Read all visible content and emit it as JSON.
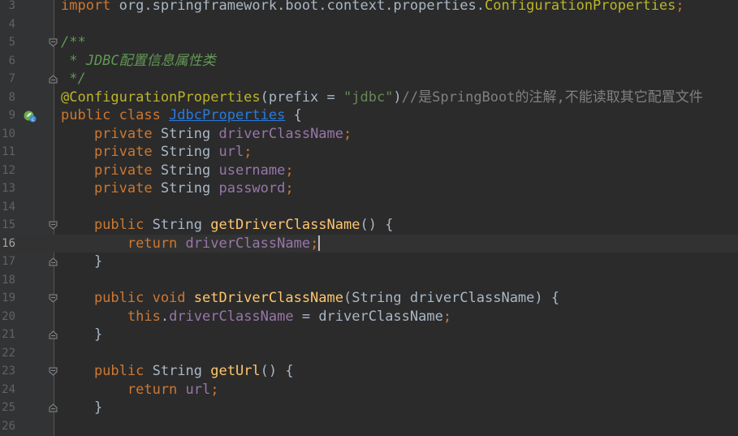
{
  "editor": {
    "current_line": "16",
    "lines": [
      {
        "num": "3",
        "tokens": [
          {
            "t": "kw",
            "v": "import"
          },
          {
            "t": "p",
            "v": " org.springframework.boot.context.properties."
          },
          {
            "t": "ann",
            "v": "ConfigurationProperties"
          },
          {
            "t": "kw",
            "v": ";"
          }
        ]
      },
      {
        "num": "4",
        "tokens": []
      },
      {
        "num": "5",
        "tokens": [
          {
            "t": "doc",
            "v": "/**"
          }
        ]
      },
      {
        "num": "6",
        "tokens": [
          {
            "t": "doc",
            "v": " * JDBC配置信息属性类"
          }
        ]
      },
      {
        "num": "7",
        "tokens": [
          {
            "t": "doc",
            "v": " */"
          }
        ]
      },
      {
        "num": "8",
        "tokens": [
          {
            "t": "ann",
            "v": "@ConfigurationProperties"
          },
          {
            "t": "p",
            "v": "(prefix = "
          },
          {
            "t": "str",
            "v": "\"jdbc\""
          },
          {
            "t": "p",
            "v": ")"
          },
          {
            "t": "cmt",
            "v": "//是SpringBoot的注解,不能读取其它配置文件"
          }
        ]
      },
      {
        "num": "9",
        "tokens": [
          {
            "t": "kw",
            "v": "public class "
          },
          {
            "t": "cls",
            "v": "JdbcProperties"
          },
          {
            "t": "p",
            "v": " {"
          }
        ]
      },
      {
        "num": "10",
        "tokens": [
          {
            "t": "kw",
            "v": "    private "
          },
          {
            "t": "p",
            "v": "String "
          },
          {
            "t": "field",
            "v": "driverClassName"
          },
          {
            "t": "kw",
            "v": ";"
          }
        ]
      },
      {
        "num": "11",
        "tokens": [
          {
            "t": "kw",
            "v": "    private "
          },
          {
            "t": "p",
            "v": "String "
          },
          {
            "t": "field",
            "v": "url"
          },
          {
            "t": "kw",
            "v": ";"
          }
        ]
      },
      {
        "num": "12",
        "tokens": [
          {
            "t": "kw",
            "v": "    private "
          },
          {
            "t": "p",
            "v": "String "
          },
          {
            "t": "field",
            "v": "username"
          },
          {
            "t": "kw",
            "v": ";"
          }
        ]
      },
      {
        "num": "13",
        "tokens": [
          {
            "t": "kw",
            "v": "    private "
          },
          {
            "t": "p",
            "v": "String "
          },
          {
            "t": "field",
            "v": "password"
          },
          {
            "t": "kw",
            "v": ";"
          }
        ]
      },
      {
        "num": "14",
        "tokens": []
      },
      {
        "num": "15",
        "tokens": [
          {
            "t": "kw",
            "v": "    public "
          },
          {
            "t": "p",
            "v": "String "
          },
          {
            "t": "meth",
            "v": "getDriverClassName"
          },
          {
            "t": "p",
            "v": "() {"
          }
        ]
      },
      {
        "num": "16",
        "tokens": [
          {
            "t": "kw",
            "v": "        return "
          },
          {
            "t": "field",
            "v": "driverClassName"
          },
          {
            "t": "kw",
            "v": ";"
          },
          {
            "t": "caret",
            "v": ""
          }
        ]
      },
      {
        "num": "17",
        "tokens": [
          {
            "t": "p",
            "v": "    }"
          }
        ]
      },
      {
        "num": "18",
        "tokens": []
      },
      {
        "num": "19",
        "tokens": [
          {
            "t": "kw",
            "v": "    public void "
          },
          {
            "t": "meth",
            "v": "setDriverClassName"
          },
          {
            "t": "p",
            "v": "(String driverClassName) {"
          }
        ]
      },
      {
        "num": "20",
        "tokens": [
          {
            "t": "kw",
            "v": "        this"
          },
          {
            "t": "p",
            "v": "."
          },
          {
            "t": "field",
            "v": "driverClassName"
          },
          {
            "t": "p",
            "v": " = driverClassName"
          },
          {
            "t": "kw",
            "v": ";"
          }
        ]
      },
      {
        "num": "21",
        "tokens": [
          {
            "t": "p",
            "v": "    }"
          }
        ]
      },
      {
        "num": "22",
        "tokens": []
      },
      {
        "num": "23",
        "tokens": [
          {
            "t": "kw",
            "v": "    public "
          },
          {
            "t": "p",
            "v": "String "
          },
          {
            "t": "meth",
            "v": "getUrl"
          },
          {
            "t": "p",
            "v": "() {"
          }
        ]
      },
      {
        "num": "24",
        "tokens": [
          {
            "t": "kw",
            "v": "        return "
          },
          {
            "t": "field",
            "v": "url"
          },
          {
            "t": "kw",
            "v": ";"
          }
        ]
      },
      {
        "num": "25",
        "tokens": [
          {
            "t": "p",
            "v": "    }"
          }
        ]
      },
      {
        "num": "26",
        "tokens": []
      }
    ],
    "markers": {
      "9": "spring-bean-icon"
    },
    "folds": {
      "5": "fold-open-icon",
      "7": "fold-close-icon",
      "15": "fold-open-icon",
      "17": "fold-close-icon",
      "19": "fold-open-icon",
      "21": "fold-close-icon",
      "23": "fold-open-icon",
      "25": "fold-close-icon"
    }
  }
}
